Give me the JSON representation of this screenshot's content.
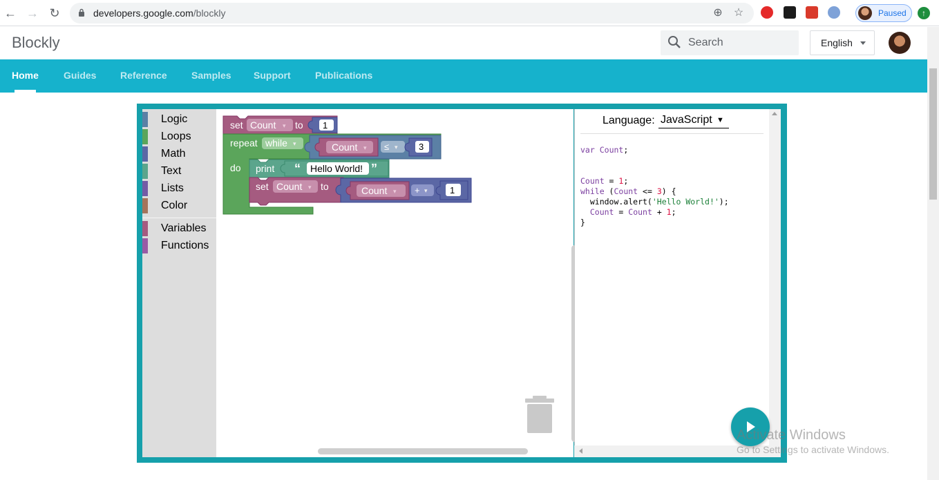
{
  "browser": {
    "url_host": "developers.google.com",
    "url_path": "/blockly",
    "profile_status": "Paused"
  },
  "site": {
    "brand": "Blockly",
    "search_placeholder": "Search",
    "language": "English"
  },
  "tabs": [
    {
      "label": "Home",
      "active": true
    },
    {
      "label": "Guides",
      "active": false
    },
    {
      "label": "Reference",
      "active": false
    },
    {
      "label": "Samples",
      "active": false
    },
    {
      "label": "Support",
      "active": false
    },
    {
      "label": "Publications",
      "active": false
    }
  ],
  "toolbox": {
    "categories": [
      {
        "name": "Logic",
        "color": "#5b80a5"
      },
      {
        "name": "Loops",
        "color": "#5ba55b"
      },
      {
        "name": "Math",
        "color": "#5b67a5"
      },
      {
        "name": "Text",
        "color": "#5ba58c"
      },
      {
        "name": "Lists",
        "color": "#745ba5"
      },
      {
        "name": "Color",
        "color": "#a5745b"
      },
      {
        "name": "Variables",
        "color": "#a55b80"
      },
      {
        "name": "Functions",
        "color": "#995ba5"
      }
    ]
  },
  "blocks": {
    "set_kw": "set",
    "to_kw": "to",
    "var_name": "Count",
    "init_value": "1",
    "repeat_kw": "repeat",
    "while_opt": "while",
    "do_kw": "do",
    "compare_op": "≤",
    "limit_value": "3",
    "print_kw": "print",
    "open_quote": "“",
    "close_quote": "”",
    "message": "Hello World!",
    "plus_op": "+",
    "increment": "1",
    "dropdown_arrow": "▾"
  },
  "code_panel": {
    "language_label": "Language:",
    "language_value": "JavaScript",
    "language_arrow": "▼",
    "lines": [
      "var Count;",
      "",
      "",
      "Count = 1;",
      "while (Count <= 3) {",
      "  window.alert('Hello World!');",
      "  Count = Count + 1;",
      "}"
    ]
  },
  "watermark": {
    "line1": "Activate Windows",
    "line2": "Go to Settings to activate Windows."
  }
}
